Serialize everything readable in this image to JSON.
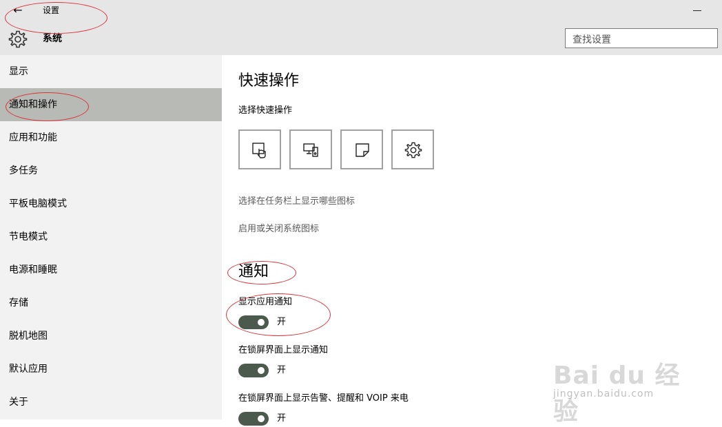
{
  "window": {
    "back_glyph": "←",
    "title": "设置",
    "section_title": "系统"
  },
  "search": {
    "placeholder": "查找设置"
  },
  "sidebar": {
    "items": [
      {
        "label": "显示",
        "active": false
      },
      {
        "label": "通知和操作",
        "active": true
      },
      {
        "label": "应用和功能",
        "active": false
      },
      {
        "label": "多任务",
        "active": false
      },
      {
        "label": "平板电脑模式",
        "active": false
      },
      {
        "label": "节电模式",
        "active": false
      },
      {
        "label": "电源和睡眠",
        "active": false
      },
      {
        "label": "存储",
        "active": false
      },
      {
        "label": "脱机地图",
        "active": false
      },
      {
        "label": "默认应用",
        "active": false
      },
      {
        "label": "关于",
        "active": false
      }
    ]
  },
  "quick_actions": {
    "heading": "快速操作",
    "subheading": "选择快速操作",
    "tiles": [
      {
        "icon": "tablet-mode-icon"
      },
      {
        "icon": "project-icon"
      },
      {
        "icon": "note-icon"
      },
      {
        "icon": "settings-icon"
      }
    ],
    "link_taskbar_icons": "选择在任务栏上显示哪些图标",
    "link_system_icons": "启用或关闭系统图标"
  },
  "notifications": {
    "heading": "通知",
    "settings": [
      {
        "label": "显示应用通知",
        "state": "开"
      },
      {
        "label": "在锁屏界面上显示通知",
        "state": "开"
      },
      {
        "label": "在锁屏界面上显示告警、提醒和 VOIP 来电",
        "state": "开"
      }
    ]
  },
  "watermark": {
    "logo": "Bai du 经验",
    "url": "jingyan.baidu.com"
  },
  "colors": {
    "titlebar": "#e6e6e6",
    "sidebar": "#f2f2f2",
    "active_nav": "#b8bab6",
    "toggle_on": "#4c5a4d",
    "annotation_ellipse": "#d9333a"
  }
}
